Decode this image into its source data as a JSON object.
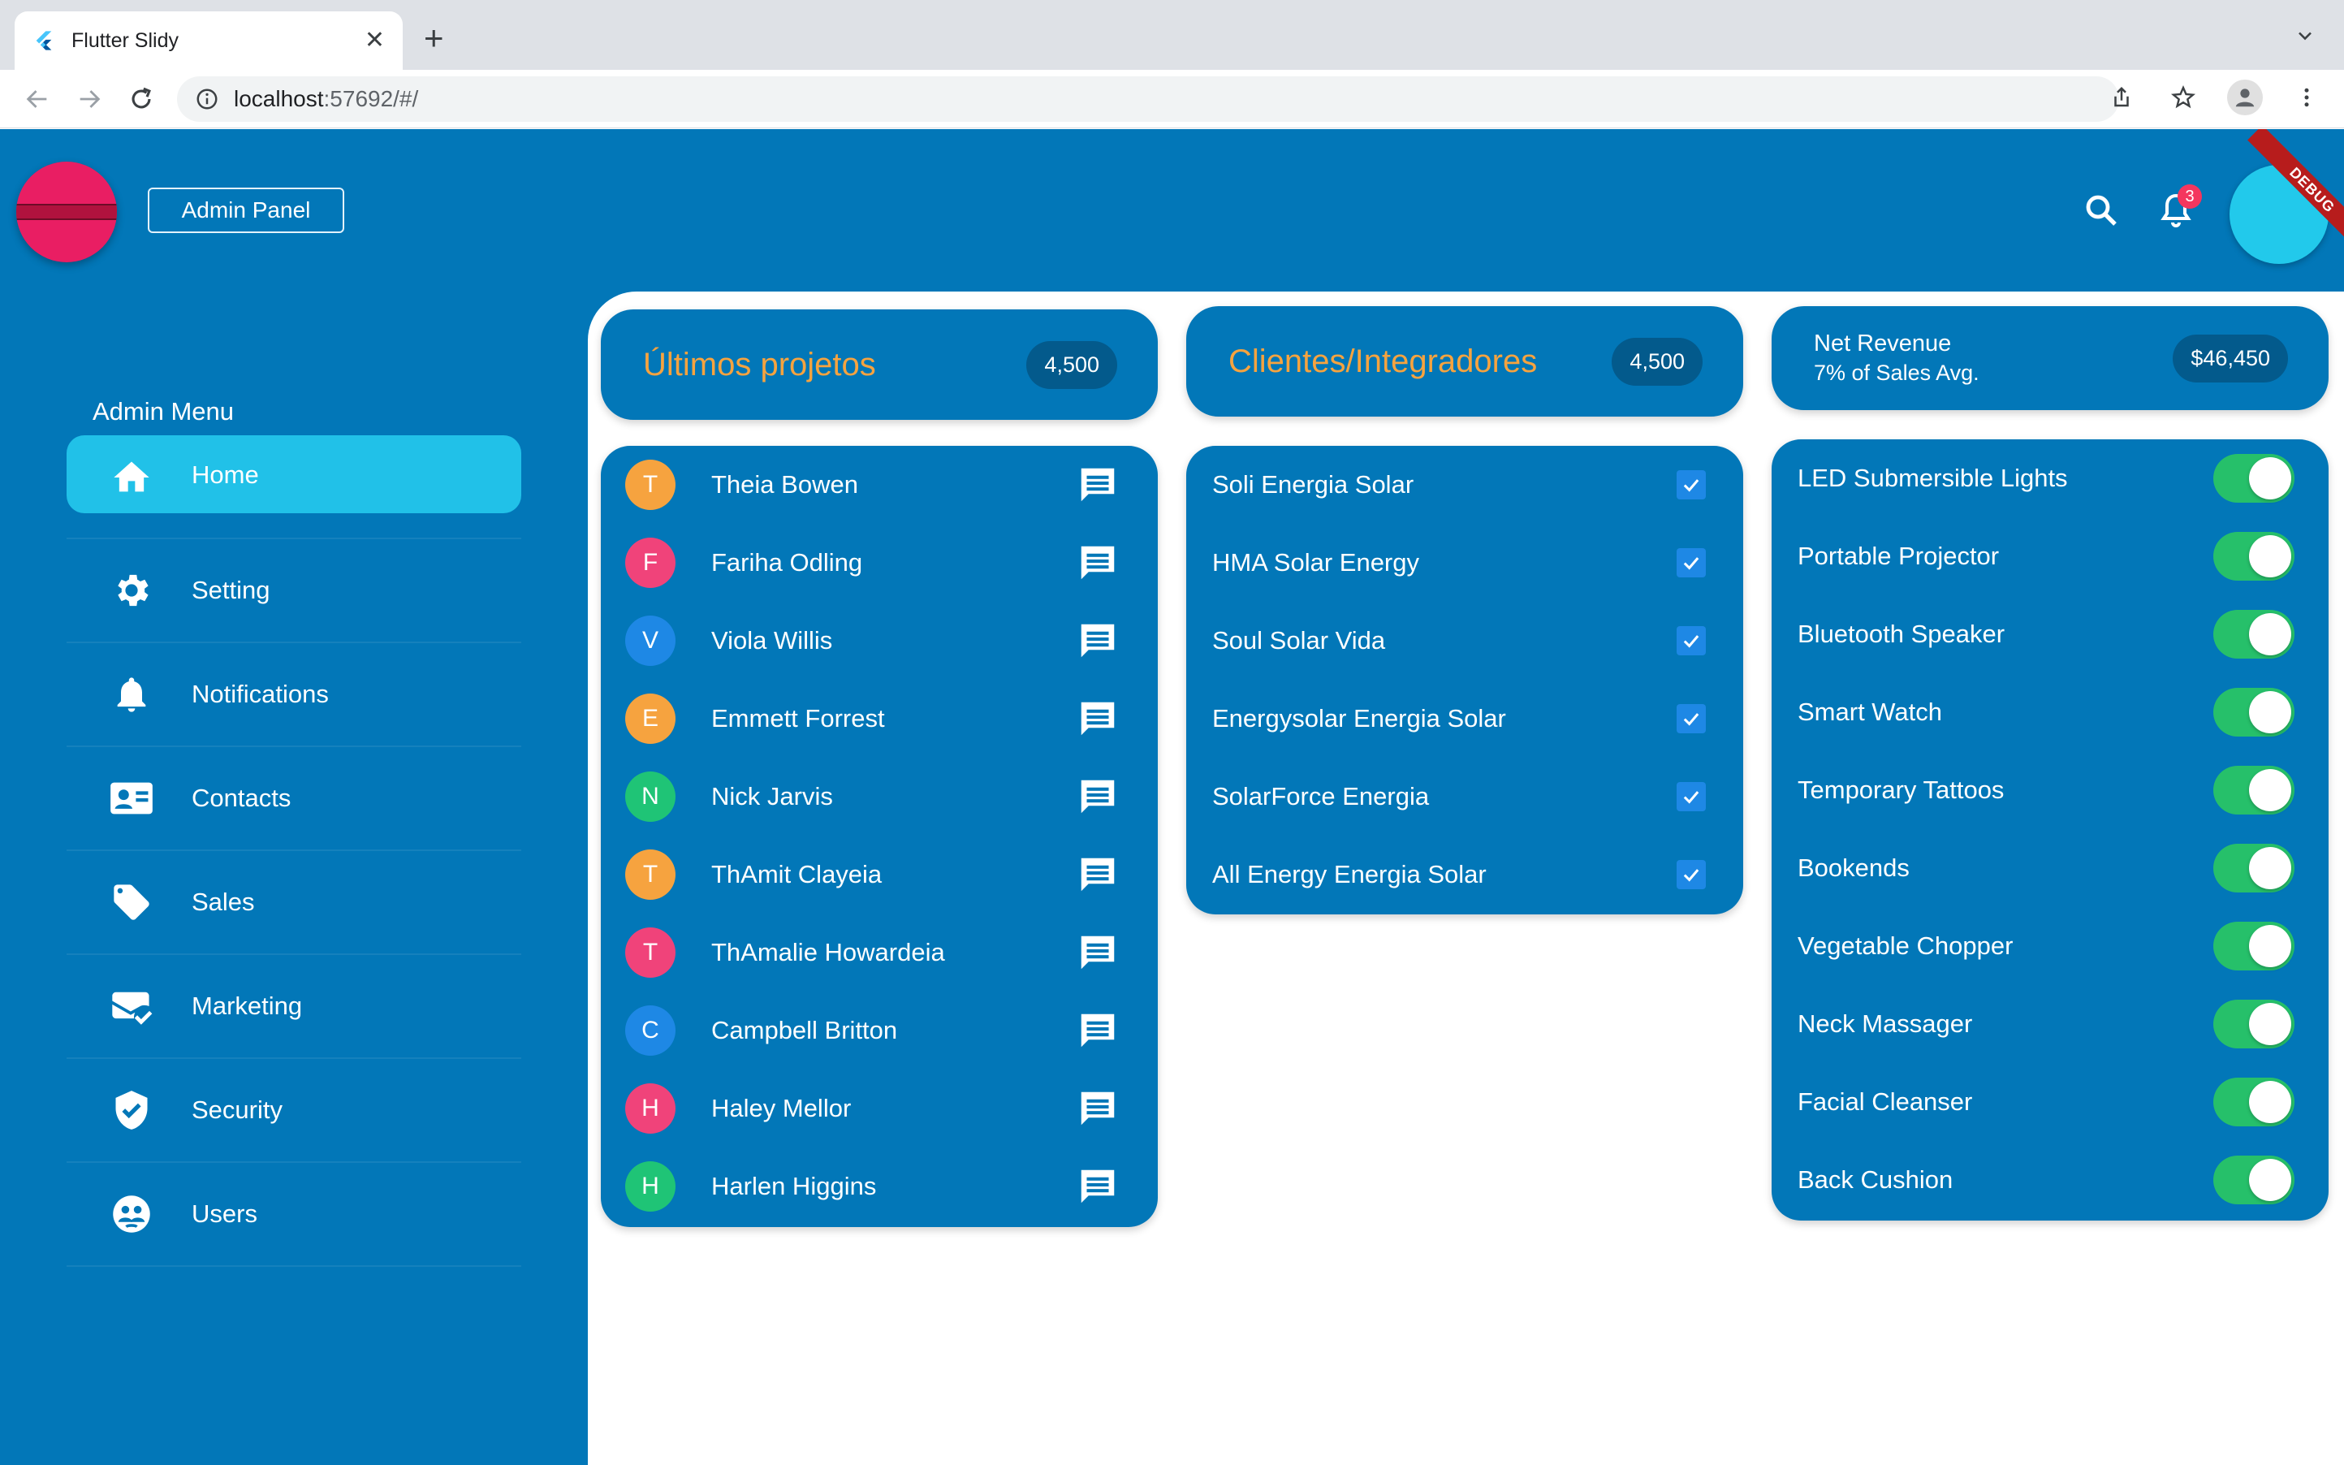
{
  "browser": {
    "tab_title": "Flutter Slidy",
    "url_host": "localhost",
    "url_rest": ":57692/#/"
  },
  "header": {
    "admin_button": "Admin Panel",
    "notification_count": "3",
    "debug_label": "DEBUG"
  },
  "sidebar": {
    "title": "Admin Menu",
    "items": [
      {
        "label": "Home",
        "icon": "home-icon"
      },
      {
        "label": "Setting",
        "icon": "gear-icon"
      },
      {
        "label": "Notifications",
        "icon": "bell-icon"
      },
      {
        "label": "Contacts",
        "icon": "contacts-icon"
      },
      {
        "label": "Sales",
        "icon": "tag-icon"
      },
      {
        "label": "Marketing",
        "icon": "mark-email-icon"
      },
      {
        "label": "Security",
        "icon": "shield-check-icon"
      },
      {
        "label": "Users",
        "icon": "users-icon"
      }
    ]
  },
  "projects": {
    "title": "Últimos projetos",
    "count": "4,500",
    "people": [
      {
        "initial": "T",
        "name": "Theia Bowen",
        "color": "#f6a33f"
      },
      {
        "initial": "F",
        "name": "Fariha Odling",
        "color": "#f0437a"
      },
      {
        "initial": "V",
        "name": "Viola Willis",
        "color": "#1e88e5"
      },
      {
        "initial": "E",
        "name": "Emmett Forrest",
        "color": "#f6a33f"
      },
      {
        "initial": "N",
        "name": "Nick Jarvis",
        "color": "#1fc476"
      },
      {
        "initial": "T",
        "name": "ThAmit Clayeia",
        "color": "#f6a33f"
      },
      {
        "initial": "T",
        "name": "ThAmalie Howardeia",
        "color": "#f0437a"
      },
      {
        "initial": "C",
        "name": "Campbell Britton",
        "color": "#1e88e5"
      },
      {
        "initial": "H",
        "name": "Haley Mellor",
        "color": "#f0437a"
      },
      {
        "initial": "H",
        "name": "Harlen Higgins",
        "color": "#1fc476"
      }
    ]
  },
  "clients": {
    "title": "Clientes/Integradores",
    "count": "4,500",
    "items": [
      {
        "name": "Soli Energia Solar",
        "checked": true
      },
      {
        "name": "HMA Solar Energy",
        "checked": true
      },
      {
        "name": "Soul Solar Vida",
        "checked": true
      },
      {
        "name": "Energysolar Energia Solar",
        "checked": true
      },
      {
        "name": "SolarForce Energia",
        "checked": true
      },
      {
        "name": "All Energy Energia Solar",
        "checked": true
      }
    ]
  },
  "revenue": {
    "title": "Net Revenue",
    "subtitle": "7% of Sales Avg.",
    "amount": "$46,450",
    "products": [
      {
        "name": "LED Submersible Lights",
        "on": true
      },
      {
        "name": "Portable Projector",
        "on": true
      },
      {
        "name": "Bluetooth Speaker",
        "on": true
      },
      {
        "name": "Smart Watch",
        "on": true
      },
      {
        "name": "Temporary Tattoos",
        "on": true
      },
      {
        "name": "Bookends",
        "on": true
      },
      {
        "name": "Vegetable Chopper",
        "on": true
      },
      {
        "name": "Neck Massager",
        "on": true
      },
      {
        "name": "Facial Cleanser",
        "on": true
      },
      {
        "name": "Back Cushion",
        "on": true
      }
    ]
  },
  "colors": {
    "app_blue": "#0277b8",
    "highlight_cyan": "#21c1e8",
    "title_orange": "#f6a33f",
    "toggle_green": "#26c06a",
    "avatar_cyan": "#22c9eb",
    "logo_pink": "#e91e63"
  }
}
